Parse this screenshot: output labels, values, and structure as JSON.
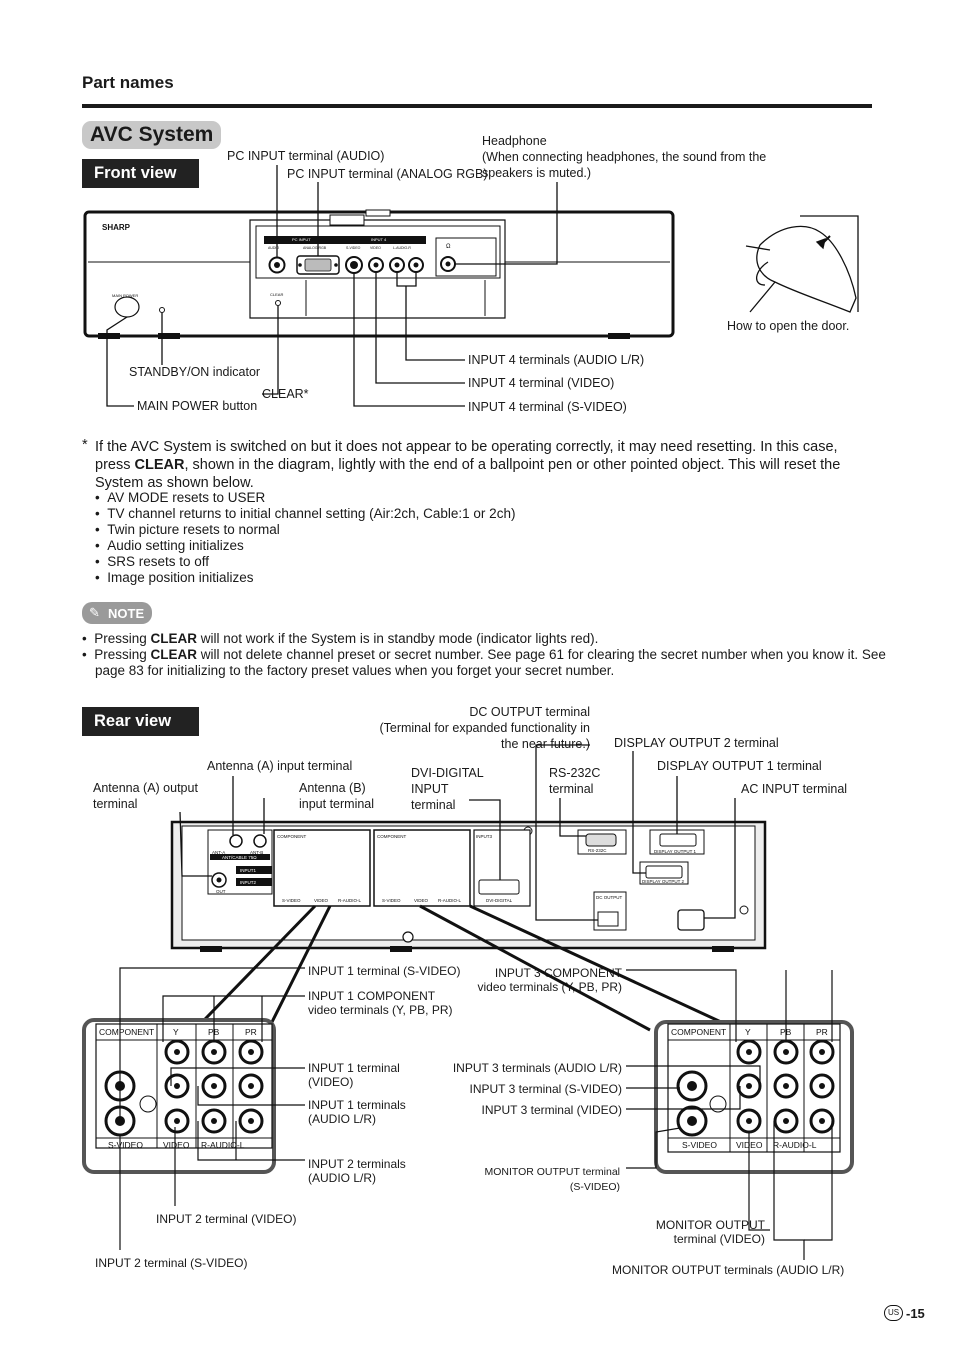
{
  "header": {
    "section": "Part names",
    "title": "AVC System"
  },
  "front_view": {
    "tab": "Front view",
    "callouts": {
      "pc_audio": "PC INPUT terminal (AUDIO)",
      "pc_rgb": "PC INPUT terminal (ANALOG RGB)",
      "headphone": [
        "Headphone",
        "(When connecting headphones, the sound from the",
        "speakers is muted.)"
      ],
      "standby": "STANDBY/ON indicator",
      "main_power": "MAIN POWER button",
      "clear": "CLEAR*",
      "in4_audio": "INPUT 4 terminals (AUDIO L/R)",
      "in4_video": "INPUT 4 terminal (VIDEO)",
      "in4_svideo": "INPUT 4 terminal (S-VIDEO)",
      "door": "How to open the door."
    },
    "panel": {
      "brand": "SHARP",
      "main_power": "MAIN POWER",
      "pc_input": "PC INPUT",
      "audio": "AUDIO",
      "analog_rgb": "ANALOG RGB",
      "input4": "INPUT 4",
      "svideo": "S-VIDEO",
      "video": "VIDEO",
      "audio_lr": "L-AUDIO-R",
      "clear": "CLEAR",
      "headphone_symbol": "Ω"
    }
  },
  "reset_note": {
    "asterisk": "*",
    "text_before": "If the AVC System is switched on but it does not appear to be operating correctly, it may need resetting. In this case, press ",
    "clear": "CLEAR",
    "text_after": ", shown in the diagram, lightly with the end of a ballpoint pen or other pointed object. This will reset the System as shown below.",
    "items": [
      "AV MODE resets to USER",
      "TV channel returns to initial channel setting (Air:2ch, Cable:1 or 2ch)",
      "Twin picture resets to normal",
      "Audio setting initializes",
      "SRS resets to off",
      "Image position initializes"
    ]
  },
  "note": {
    "badge": "NOTE",
    "items": [
      {
        "before": "Pressing ",
        "bold": "CLEAR",
        "after": " will not work if the System is in standby mode (indicator lights red)."
      },
      {
        "before": "Pressing ",
        "bold": "CLEAR",
        "after": " will not delete channel preset or secret number. See page 61 for clearing the secret number when you know it. See page 83 for initializing to the factory preset values when you forget your secret number."
      }
    ]
  },
  "rear_view": {
    "tab": "Rear view",
    "callouts": {
      "dc_output": [
        "DC OUTPUT terminal",
        "(Terminal for expanded functionality in",
        "the near future.)"
      ],
      "display2": "DISPLAY OUTPUT 2 terminal",
      "antenna_a_input": "Antenna (A) input terminal",
      "dvi": [
        "DVI-DIGITAL",
        "INPUT",
        "terminal"
      ],
      "rs232c": [
        "RS-232C",
        "terminal"
      ],
      "display1": "DISPLAY OUTPUT 1 terminal",
      "antenna_a_output": [
        "Antenna (A) output",
        "terminal"
      ],
      "antenna_b_input": [
        "Antenna (B)",
        "input terminal"
      ],
      "ac_input": "AC INPUT terminal",
      "in1_svideo": "INPUT 1 terminal (S-VIDEO)",
      "in1_component": [
        "INPUT 1 COMPONENT",
        "video terminals (Y, PB, PR)"
      ],
      "in1_video": [
        "INPUT 1 terminal",
        "(VIDEO)"
      ],
      "in1_audio": [
        "INPUT 1 terminals",
        "(AUDIO L/R)"
      ],
      "in2_audio": [
        "INPUT 2 terminals",
        "(AUDIO L/R)"
      ],
      "in2_video": "INPUT 2 terminal (VIDEO)",
      "in2_svideo": "INPUT 2 terminal (S-VIDEO)",
      "in3_component": [
        "INPUT 3 COMPONENT",
        "video terminals (Y, PB, PR)"
      ],
      "in3_audio": "INPUT 3 terminals (AUDIO L/R)",
      "in3_svideo": "INPUT 3 terminal (S-VIDEO)",
      "in3_video": "INPUT 3 terminal (VIDEO)",
      "mon_svideo": [
        "MONITOR OUTPUT terminal",
        "(S-VIDEO)"
      ],
      "mon_video": [
        "MONITOR OUTPUT",
        "terminal (VIDEO)"
      ],
      "mon_audio": "MONITOR OUTPUT terminals (AUDIO L/R)"
    },
    "panel": {
      "component": "COMPONENT",
      "y": "Y",
      "pb": "PB",
      "pr": "PR",
      "svideo": "S-VIDEO",
      "video": "VIDEO",
      "audio": "R-AUDIO-L",
      "dvi_digital": "DVI-DIGITAL",
      "ant_a": "ANT-A",
      "ant_b": "ANT-B",
      "out": "OUT",
      "ant_cable": "ANT/CABLE 75Ω",
      "input1": "INPUT1",
      "input2": "INPUT2",
      "input3": "INPUT3",
      "display1": "DISPLAY OUTPUT 1",
      "display2": "DISPLAY OUTPUT 2",
      "dc_output": "DC OUTPUT",
      "rs232c": "RS-232C"
    }
  },
  "footer": {
    "region": "US",
    "page": "-15"
  }
}
